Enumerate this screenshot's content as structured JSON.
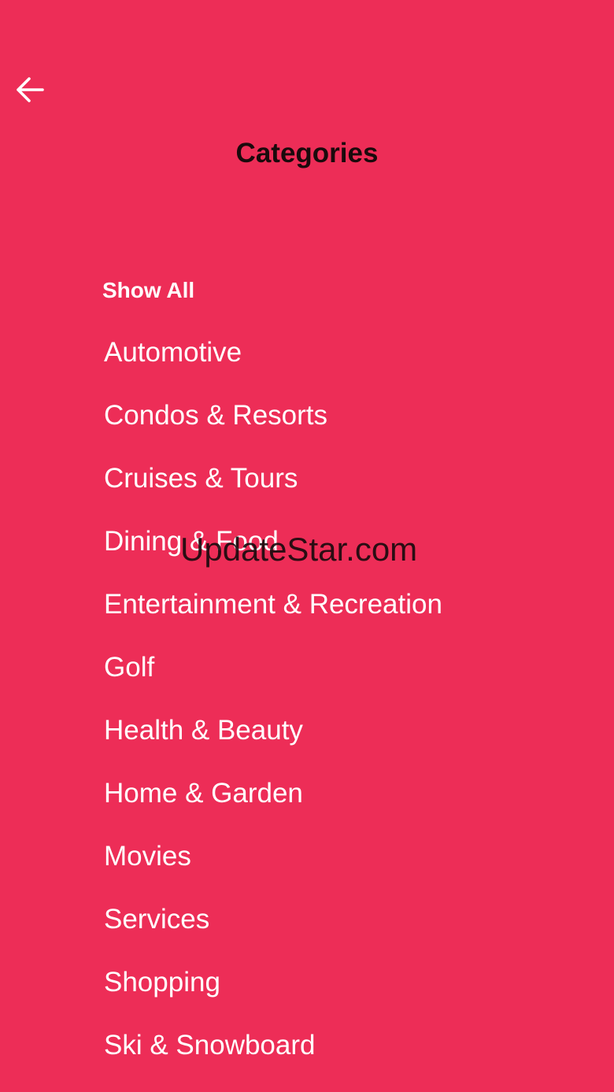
{
  "theme": {
    "background": "#ED2D57",
    "text": "#FFFFFF",
    "title": "#1A0A0C"
  },
  "header": {
    "back_icon": "arrow-left-icon",
    "title": "Categories"
  },
  "categories": [
    "Show All",
    "Automotive",
    "Condos & Resorts",
    "Cruises & Tours",
    "Dining & Food",
    "Entertainment & Recreation",
    "Golf",
    "Health & Beauty",
    "Home & Garden",
    "Movies",
    "Services",
    "Shopping",
    "Ski & Snowboard"
  ],
  "watermark": "UpdateStar.com"
}
